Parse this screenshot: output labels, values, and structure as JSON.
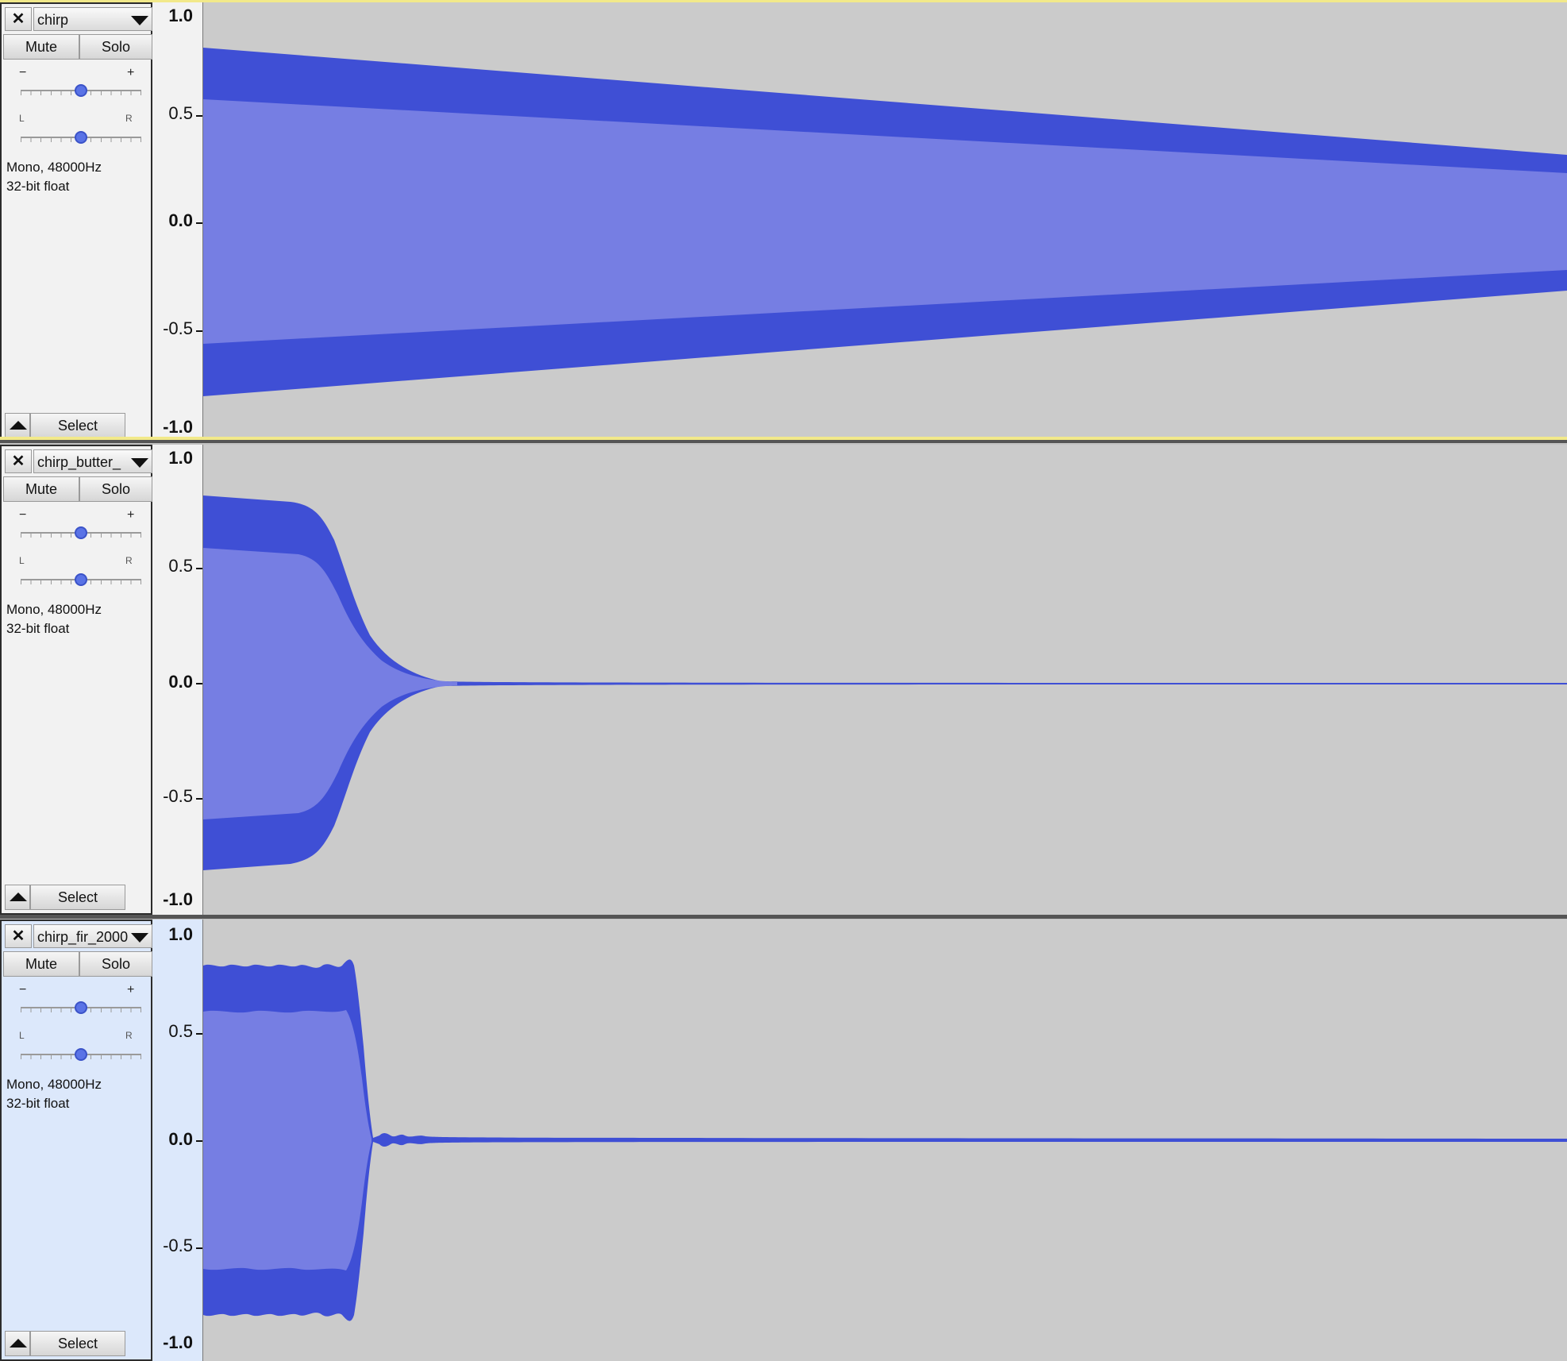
{
  "colors": {
    "track_bg": "#cbcbcb",
    "rms": "#767ee3",
    "peak": "#3f4fd5",
    "selected_panel": "#dce8fb"
  },
  "icons": {
    "close": "close-icon",
    "menu": "chevron-down-icon",
    "collapse": "collapse-up-icon"
  },
  "tracks": [
    {
      "name": "chirp",
      "close_label": "✕",
      "mute_label": "Mute",
      "solo_label": "Solo",
      "gain_minus": "−",
      "gain_plus": "+",
      "pan_left": "L",
      "pan_right": "R",
      "gain_position": 0.5,
      "pan_position": 0.5,
      "info_line1": "Mono, 48000Hz",
      "info_line2": "32-bit float",
      "select_label": "Select",
      "scale": [
        "1.0",
        "0.5",
        "0.0",
        "-0.5",
        "-1.0"
      ],
      "selected": false
    },
    {
      "name": "chirp_butter_",
      "close_label": "✕",
      "mute_label": "Mute",
      "solo_label": "Solo",
      "gain_minus": "−",
      "gain_plus": "+",
      "pan_left": "L",
      "pan_right": "R",
      "gain_position": 0.5,
      "pan_position": 0.5,
      "info_line1": "Mono, 48000Hz",
      "info_line2": "32-bit float",
      "select_label": "Select",
      "scale": [
        "1.0",
        "0.5",
        "0.0",
        "-0.5",
        "-1.0"
      ],
      "selected": false
    },
    {
      "name": "chirp_fir_2000",
      "close_label": "✕",
      "mute_label": "Mute",
      "solo_label": "Solo",
      "gain_minus": "−",
      "gain_plus": "+",
      "pan_left": "L",
      "pan_right": "R",
      "gain_position": 0.5,
      "pan_position": 0.5,
      "info_line1": "Mono, 48000Hz",
      "info_line2": "32-bit float",
      "select_label": "Select",
      "scale": [
        "1.0",
        "0.5",
        "0.0",
        "-0.5",
        "-1.0"
      ],
      "selected": true
    }
  ]
}
